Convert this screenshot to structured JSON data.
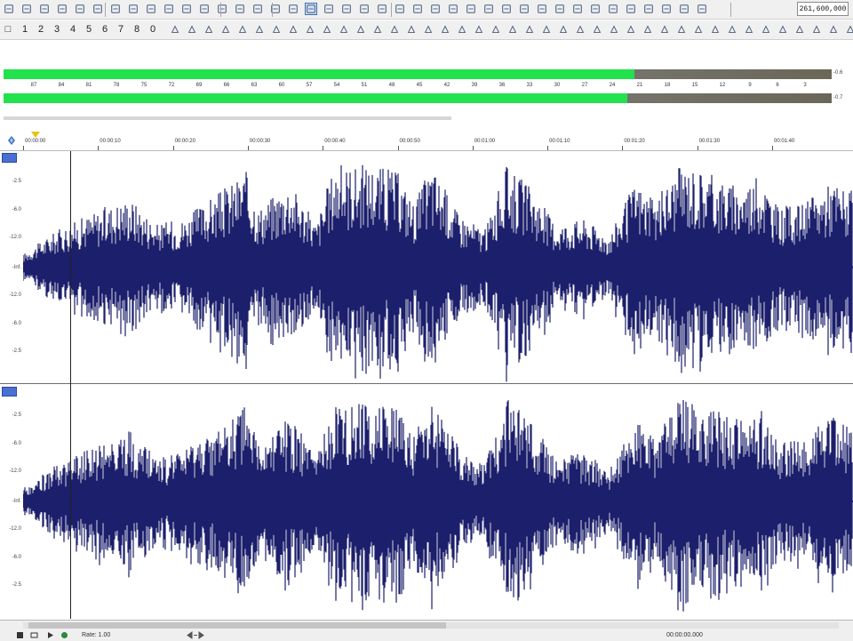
{
  "toolbar1": {
    "counter_value": "261,600,000"
  },
  "toolbar2": {
    "marker_numbers": [
      "1",
      "2",
      "3",
      "4",
      "5",
      "6",
      "7",
      "8",
      "0"
    ]
  },
  "meters": {
    "scale_ticks": [
      "87",
      "84",
      "81",
      "78",
      "75",
      "72",
      "69",
      "66",
      "63",
      "60",
      "57",
      "54",
      "51",
      "48",
      "45",
      "42",
      "39",
      "36",
      "33",
      "30",
      "27",
      "24",
      "21",
      "18",
      "15",
      "12",
      "9",
      "6",
      "3"
    ],
    "channel_left": {
      "level_fraction": 0.762,
      "peak_text": "-0.6"
    },
    "channel_right": {
      "level_fraction": 0.753,
      "peak_text": "-0.7"
    },
    "colors": {
      "fill": "#21e24d",
      "track": "#7a786f"
    }
  },
  "timeline": {
    "labels": [
      "00:00:00",
      "00:00:10",
      "00:00:20",
      "00:00:30",
      "00:00:40",
      "00:00:50",
      "00:01:00",
      "00:01:10",
      "00:01:20",
      "00:01:30",
      "00:01:40"
    ]
  },
  "channels": {
    "ch1_amp_labels": [
      "-2.5",
      "-6.0",
      "-12.0",
      "-Inf.",
      "-12.0",
      "-6.0",
      "-2.5"
    ],
    "ch2_amp_labels": [
      "-2.5",
      "-6.0",
      "-12.0",
      "-Inf.",
      "-12.0",
      "-6.0",
      "-2.5"
    ],
    "wave_color": "#1c1f6b"
  },
  "status": {
    "rate_label": "Rate: 1.00",
    "position_label": "00:00:00.000"
  }
}
